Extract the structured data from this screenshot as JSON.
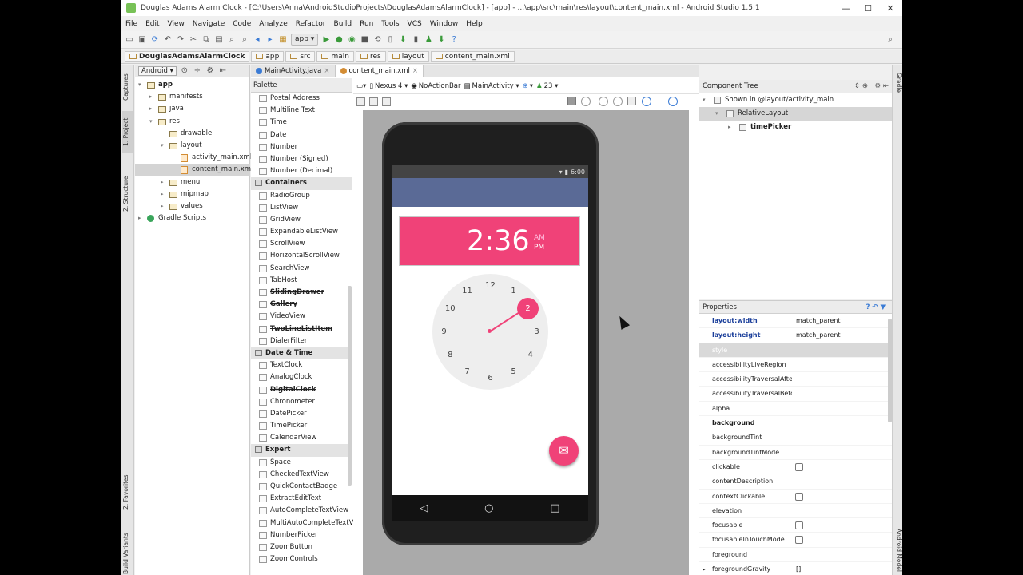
{
  "window": {
    "title": "Douglas Adams Alarm Clock - [C:\\Users\\Anna\\AndroidStudioProjects\\DouglasAdamsAlarmClock] - [app] - ...\\app\\src\\main\\res\\layout\\content_main.xml - Android Studio 1.5.1",
    "minimize": "—",
    "maximize": "☐",
    "close": "✕"
  },
  "menu": [
    "File",
    "Edit",
    "View",
    "Navigate",
    "Code",
    "Analyze",
    "Refactor",
    "Build",
    "Run",
    "Tools",
    "VCS",
    "Window",
    "Help"
  ],
  "toolbar": {
    "run_config": "app ▾"
  },
  "breadcrumbs": [
    "DouglasAdamsAlarmClock",
    "app",
    "src",
    "main",
    "res",
    "layout",
    "content_main.xml"
  ],
  "left_strip": {
    "captures": "Captures",
    "project": "1: Project",
    "structure": "2: Structure",
    "favorites": "2: Favorites",
    "build_variants": "Build Variants"
  },
  "right_strip": {
    "gradle": "Gradle",
    "android_model": "Android Model"
  },
  "project": {
    "view_selector": "Android ▾",
    "tree": [
      {
        "label": "app",
        "depth": 0,
        "arrow": "▾",
        "icon": "folder",
        "bold": true
      },
      {
        "label": "manifests",
        "depth": 1,
        "arrow": "▸",
        "icon": "folder"
      },
      {
        "label": "java",
        "depth": 1,
        "arrow": "▸",
        "icon": "folder"
      },
      {
        "label": "res",
        "depth": 1,
        "arrow": "▾",
        "icon": "folder"
      },
      {
        "label": "drawable",
        "depth": 2,
        "arrow": "",
        "icon": "folder"
      },
      {
        "label": "layout",
        "depth": 2,
        "arrow": "▾",
        "icon": "folder"
      },
      {
        "label": "activity_main.xml",
        "depth": 3,
        "arrow": "",
        "icon": "xml"
      },
      {
        "label": "content_main.xml",
        "depth": 3,
        "arrow": "",
        "icon": "xml",
        "selected": true
      },
      {
        "label": "menu",
        "depth": 2,
        "arrow": "▸",
        "icon": "folder"
      },
      {
        "label": "mipmap",
        "depth": 2,
        "arrow": "▸",
        "icon": "folder"
      },
      {
        "label": "values",
        "depth": 2,
        "arrow": "▸",
        "icon": "folder"
      },
      {
        "label": "Gradle Scripts",
        "depth": 0,
        "arrow": "▸",
        "icon": "gradle"
      }
    ]
  },
  "editor_tabs": [
    {
      "label": "MainActivity.java",
      "color": "#3a7bd5",
      "active": false
    },
    {
      "label": "content_main.xml",
      "color": "#d38c33",
      "active": true
    }
  ],
  "palette": {
    "title": "Palette",
    "items": [
      {
        "label": "Postal Address"
      },
      {
        "label": "Multiline Text"
      },
      {
        "label": "Time"
      },
      {
        "label": "Date"
      },
      {
        "label": "Number"
      },
      {
        "label": "Number (Signed)"
      },
      {
        "label": "Number (Decimal)"
      },
      {
        "label": "Containers",
        "section": true
      },
      {
        "label": "RadioGroup"
      },
      {
        "label": "ListView"
      },
      {
        "label": "GridView"
      },
      {
        "label": "ExpandableListView"
      },
      {
        "label": "ScrollView"
      },
      {
        "label": "HorizontalScrollView"
      },
      {
        "label": "SearchView"
      },
      {
        "label": "TabHost"
      },
      {
        "label": "SlidingDrawer",
        "bold": true,
        "strike": true
      },
      {
        "label": "Gallery",
        "bold": true,
        "strike": true
      },
      {
        "label": "VideoView"
      },
      {
        "label": "TwoLineListItem",
        "bold": true,
        "strike": true
      },
      {
        "label": "DialerFilter"
      },
      {
        "label": "Date & Time",
        "section": true
      },
      {
        "label": "TextClock"
      },
      {
        "label": "AnalogClock"
      },
      {
        "label": "DigitalClock",
        "bold": true,
        "strike": true
      },
      {
        "label": "Chronometer"
      },
      {
        "label": "DatePicker"
      },
      {
        "label": "TimePicker"
      },
      {
        "label": "CalendarView"
      },
      {
        "label": "Expert",
        "section": true
      },
      {
        "label": "Space"
      },
      {
        "label": "CheckedTextView"
      },
      {
        "label": "QuickContactBadge"
      },
      {
        "label": "ExtractEditText"
      },
      {
        "label": "AutoCompleteTextView"
      },
      {
        "label": "MultiAutoCompleteTextV"
      },
      {
        "label": "NumberPicker"
      },
      {
        "label": "ZoomButton"
      },
      {
        "label": "ZoomControls"
      }
    ]
  },
  "canvas_toolbar": {
    "device": "Nexus 4 ▾",
    "theme": "NoActionBar",
    "activity": "MainActivity ▾",
    "api": "23 ▾"
  },
  "phone": {
    "status_time": "6:00",
    "time": "2:36",
    "am": "AM",
    "pm": "PM",
    "selected_number": "2",
    "dial_numbers": [
      "12",
      "1",
      "2",
      "3",
      "4",
      "5",
      "6",
      "7",
      "8",
      "9",
      "10",
      "11"
    ],
    "fab_icon": "✉",
    "nav": {
      "back": "◁",
      "home": "○",
      "recent": "□"
    }
  },
  "component_tree": {
    "title": "Component Tree",
    "rows": [
      {
        "label": "Shown in @layout/activity_main",
        "depth": 0,
        "arrow": "▾"
      },
      {
        "label": "RelativeLayout",
        "depth": 1,
        "arrow": "▾",
        "selected": true
      },
      {
        "label": "timePicker",
        "depth": 2,
        "arrow": "▸",
        "bold": true
      }
    ]
  },
  "properties": {
    "title": "Properties",
    "rows": [
      {
        "key": "layout:width",
        "value": "match_parent",
        "style": "bl"
      },
      {
        "key": "layout:height",
        "value": "match_parent",
        "style": "bl"
      },
      {
        "key": "style",
        "value": "",
        "style": "hl"
      },
      {
        "key": "accessibilityLiveRegion",
        "value": ""
      },
      {
        "key": "accessibilityTraversalAfter",
        "value": ""
      },
      {
        "key": "accessibilityTraversalBefore",
        "value": ""
      },
      {
        "key": "alpha",
        "value": ""
      },
      {
        "key": "background",
        "value": "",
        "style": "bo"
      },
      {
        "key": "backgroundTint",
        "value": ""
      },
      {
        "key": "backgroundTintMode",
        "value": ""
      },
      {
        "key": "clickable",
        "value": "",
        "check": true
      },
      {
        "key": "contentDescription",
        "value": ""
      },
      {
        "key": "contextClickable",
        "value": "",
        "check": true
      },
      {
        "key": "elevation",
        "value": ""
      },
      {
        "key": "focusable",
        "value": "",
        "check": true
      },
      {
        "key": "focusableInTouchMode",
        "value": "",
        "check": true
      },
      {
        "key": "foreground",
        "value": ""
      },
      {
        "key": "foregroundGravity",
        "value": "[]",
        "arrow": true
      }
    ]
  }
}
